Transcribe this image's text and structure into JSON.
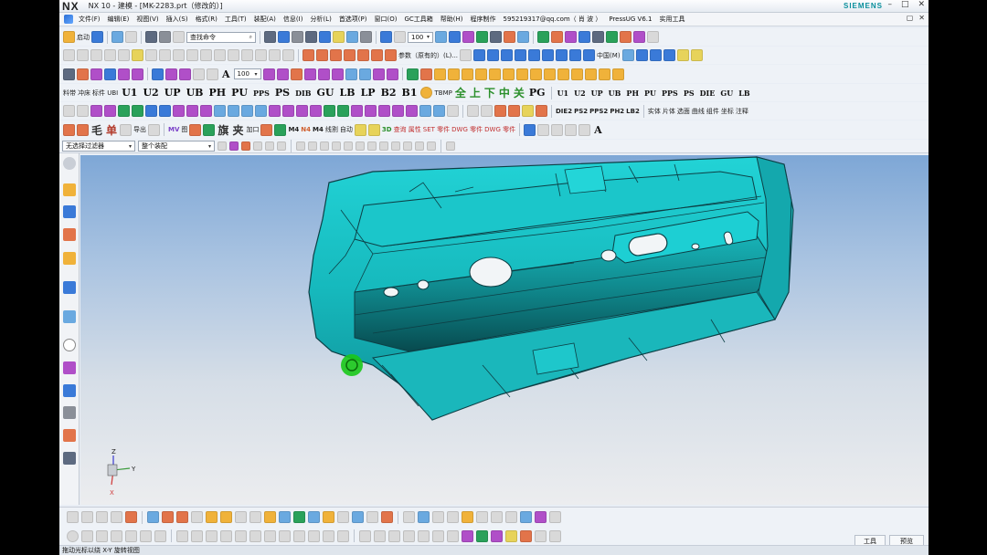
{
  "window": {
    "logo": "NX",
    "title": "NX 10 - 建模 - [MK-2283.prt（修改的）]",
    "brand": "SIEMENS",
    "controls": [
      "–",
      "□",
      "✕"
    ]
  },
  "menu": {
    "items": [
      "文件(F)",
      "编辑(E)",
      "视图(V)",
      "插入(S)",
      "格式(R)",
      "工具(T)",
      "装配(A)",
      "信息(I)",
      "分析(L)",
      "首选项(P)",
      "窗口(O)",
      "GC工具箱",
      "帮助(H)",
      "程序制作",
      "595219317@qq.com（ 肖 波 ）",
      "PressUG V6.1",
      "实用工具"
    ]
  },
  "toolbar1": {
    "start_label": "启动",
    "search_placeholder": "查找命令",
    "zoom_value": "100"
  },
  "toolbar2": {
    "param_label": "参数（原有的）(L)...",
    "mode_label": "中国(M)"
  },
  "toolbar3": {
    "zoom_value": "100"
  },
  "toolbar4": {
    "labels": [
      "料带",
      "冲床",
      "标件 UBI",
      "U1",
      "U2",
      "UP",
      "UB",
      "PH",
      "PU",
      "PPS",
      "PS",
      "DIB",
      "GU",
      "LB",
      "LP",
      "B2",
      "B1",
      "TBMP",
      "全",
      "上",
      "下",
      "中",
      "关",
      "PG",
      "U1",
      "U2",
      "UP",
      "UB",
      "PH",
      "PU",
      "PPS",
      "PS",
      "DIE",
      "GU",
      "LB"
    ]
  },
  "toolbar5": {
    "labels": [
      "DIE2",
      "PS2",
      "PPS2",
      "PH2",
      "LB2",
      "实体",
      "片体",
      "选面",
      "曲线",
      "组件",
      "坐标",
      "注释"
    ]
  },
  "toolbar6": {
    "labels": [
      "毛",
      "单",
      "导出",
      "MV",
      "图",
      "旗",
      "夹",
      "加口",
      "M4",
      "N4",
      "M4",
      "线割",
      "自动",
      "3D",
      "查询 属性",
      "SET 零件",
      "DWG 零件",
      "DWG 零件",
      "A"
    ]
  },
  "filter": {
    "type_filter": "无选择过滤器",
    "scope": "整个装配"
  },
  "status": {
    "message": "拖动光标以绕 X-Y 旋转视图",
    "tools_label": "工具",
    "preview_label": "预览"
  },
  "axes": {
    "x": "X",
    "y": "Y",
    "z": "Z"
  },
  "colors": {
    "part": "#1fc4c8",
    "edge": "#0d3f45",
    "cursor": "#19c819"
  }
}
